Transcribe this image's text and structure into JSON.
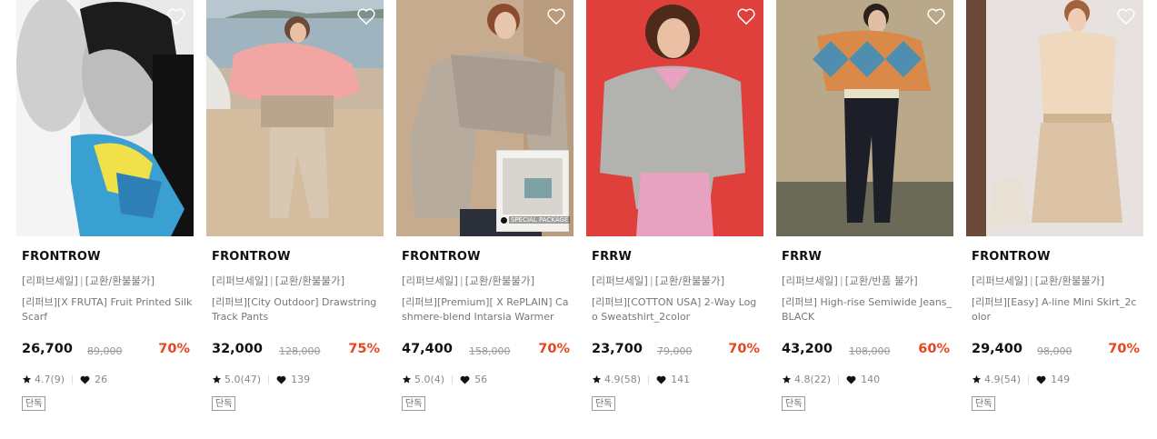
{
  "colors": {
    "accent": "#e8451e",
    "text": "#111111",
    "muted": "#777777"
  },
  "products": [
    {
      "brand": "FRONTROW",
      "tag_sale": "[리퍼브세일]",
      "tag_policy": "[교환/환불불가]",
      "title": "[리퍼브][X FRUTA] Fruit Printed Silk Scarf",
      "price": "26,700",
      "original_price": "89,000",
      "discount": "70%",
      "rating": "4.7(9)",
      "likes": "26",
      "badge": "단독",
      "photo": "black-and-white portrait with silk scarf"
    },
    {
      "brand": "FRONTROW",
      "tag_sale": "[리퍼브세일]",
      "tag_policy": "[교환/환불불가]",
      "title": "[리퍼브][City Outdoor] Drawstring Track Pants",
      "price": "32,000",
      "original_price": "128,000",
      "discount": "75%",
      "rating": "5.0(47)",
      "likes": "139",
      "badge": "단독",
      "photo": "model on beach"
    },
    {
      "brand": "FRONTROW",
      "tag_sale": "[리퍼브세일]",
      "tag_policy": "[교환/환불불가]",
      "title": "[리퍼브][Premium][ X RePLAIN] Cashmere-blend Intarsia Warmer",
      "price": "47,400",
      "original_price": "158,000",
      "discount": "70%",
      "rating": "5.0(4)",
      "likes": "56",
      "badge": "단독",
      "photo": "model in knit warmer",
      "package_label": "SPECIAL PACKAGE"
    },
    {
      "brand": "FRRW",
      "tag_sale": "[리퍼브세일]",
      "tag_policy": "[교환/환불불가]",
      "title": "[리퍼브][COTTON USA] 2-Way Logo Sweatshirt_2color",
      "price": "23,700",
      "original_price": "79,000",
      "discount": "70%",
      "rating": "4.9(58)",
      "likes": "141",
      "badge": "단독",
      "photo": "model on red background"
    },
    {
      "brand": "FRRW",
      "tag_sale": "[리퍼브세일]",
      "tag_policy": "[교환/반품 불가]",
      "title": "[리퍼브] High-rise Semiwide Jeans_BLACK",
      "price": "43,200",
      "original_price": "108,000",
      "discount": "60%",
      "rating": "4.8(22)",
      "likes": "140",
      "badge": "단독",
      "photo": "model in argyle sweater"
    },
    {
      "brand": "FRONTROW",
      "tag_sale": "[리퍼브세일]",
      "tag_policy": "[교환/환불불가]",
      "title": "[리퍼브][Easy] A-line Mini Skirt_2color",
      "price": "29,400",
      "original_price": "98,000",
      "discount": "70%",
      "rating": "4.9(54)",
      "likes": "149",
      "badge": "단독",
      "photo": "model in beige outfit"
    }
  ]
}
